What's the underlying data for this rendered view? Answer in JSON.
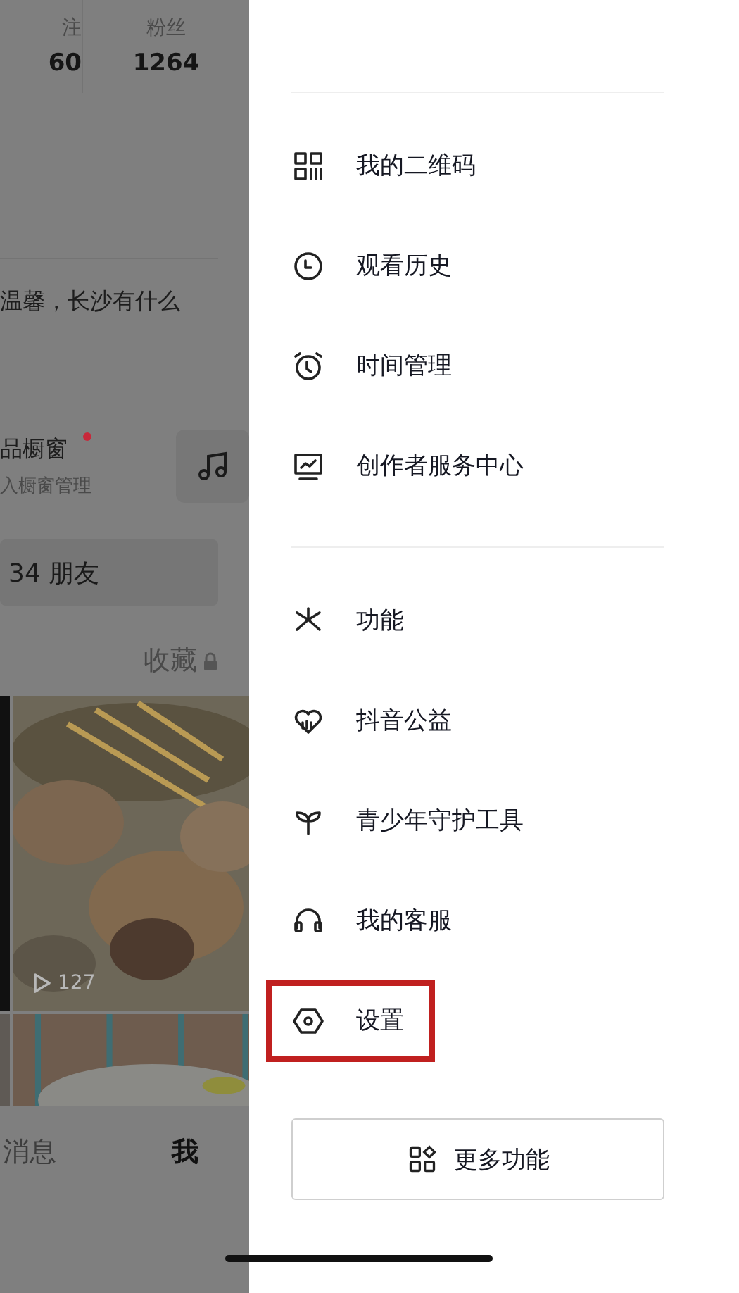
{
  "profile": {
    "stats": [
      {
        "label": "注",
        "value": "60"
      },
      {
        "label": "粉丝",
        "value": "1264"
      }
    ],
    "bio": "温馨，长沙有什么",
    "shop": {
      "title": "品橱窗",
      "subtitle": "入橱窗管理",
      "unread": true
    },
    "friends": "34 朋友",
    "tabs": [
      {
        "label": "收藏",
        "locked": true
      }
    ],
    "video": {
      "plays": "127"
    },
    "nav": [
      {
        "label": "消息",
        "selected": false
      },
      {
        "label": "我",
        "selected": true
      }
    ]
  },
  "menu": {
    "groups": [
      [
        {
          "label": "我的二维码",
          "highlighted": false
        },
        {
          "label": "观看历史",
          "highlighted": false
        },
        {
          "label": "时间管理",
          "highlighted": false
        },
        {
          "label": "创作者服务中心",
          "highlighted": false
        }
      ],
      [
        {
          "label": "功能",
          "highlighted": false
        },
        {
          "label": "抖音公益",
          "highlighted": false
        },
        {
          "label": "青少年守护工具",
          "highlighted": false
        },
        {
          "label": "我的客服",
          "highlighted": false
        },
        {
          "label": "设置",
          "highlighted": true
        }
      ]
    ],
    "more": "更多功能"
  }
}
